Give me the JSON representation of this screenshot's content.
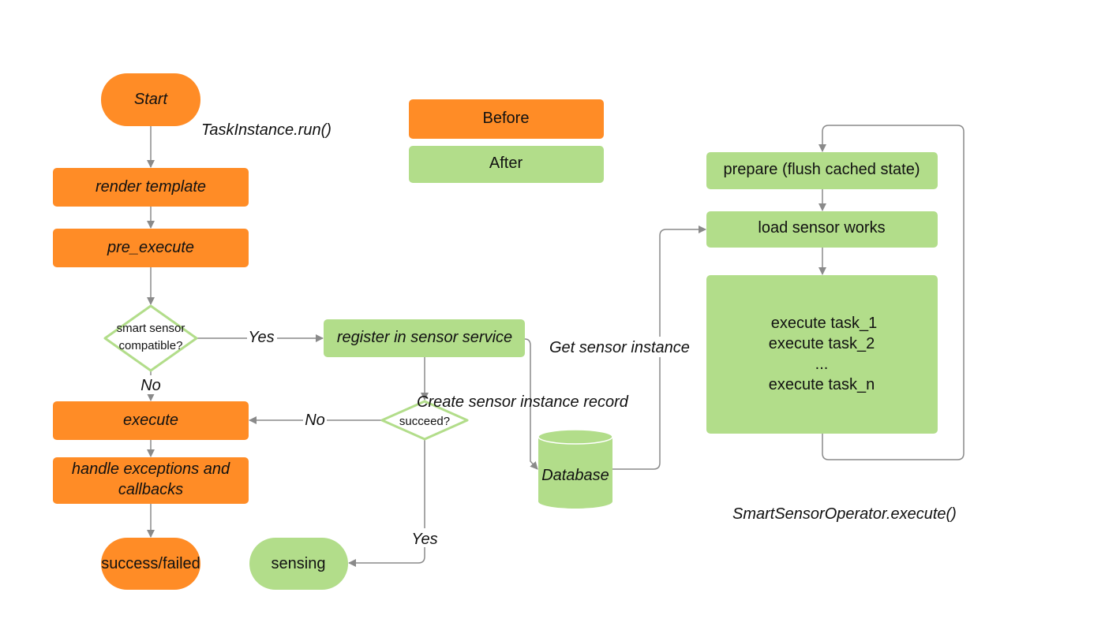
{
  "colors": {
    "before": "#FF8C26",
    "after": "#B2DD8A",
    "connector": "#8A8A8A"
  },
  "legend": {
    "before": "Before",
    "after": "After"
  },
  "nodes": {
    "start": "Start",
    "task_run": "TaskInstance.run()",
    "render_template": "render template",
    "pre_execute": "pre_execute",
    "smart_sensor_line1": "smart sensor",
    "smart_sensor_line2": "compatible?",
    "register": "register in sensor service",
    "execute": "execute",
    "handle_line1": "handle exceptions and",
    "handle_line2": "callbacks",
    "success_failed": "success/failed",
    "succeed": "succeed?",
    "sensing": "sensing",
    "database": "Database",
    "prepare": "prepare (flush cached state)",
    "load_sensor_works": "load sensor works",
    "task_1": "execute task_1",
    "task_2": "execute task_2",
    "ellipsis": "...",
    "task_n": "execute task_n",
    "smart_sensor_operator": "SmartSensorOperator.execute()"
  },
  "edge_labels": {
    "yes_compatible": "Yes",
    "no_compatible": "No",
    "no_succeed": "No",
    "yes_succeed": "Yes",
    "create_record": "Create sensor instance record",
    "get_instance": "Get sensor instance"
  }
}
